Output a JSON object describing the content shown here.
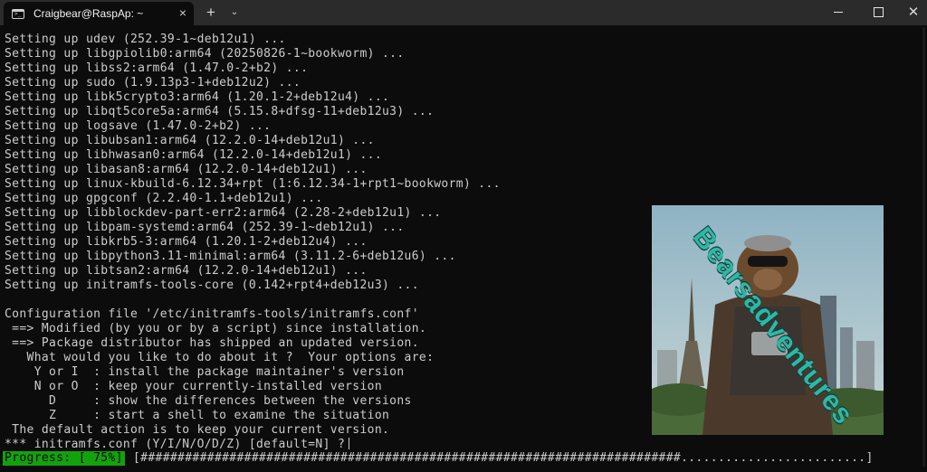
{
  "window": {
    "tab_title": "Craigbear@RaspAp: ~",
    "tab_icon": "terminal-icon",
    "close_tab": "×",
    "new_tab": "+",
    "tab_menu": "⌄",
    "close_window": "✕"
  },
  "terminal": {
    "lines": [
      "Setting up udev (252.39-1~deb12u1) ...",
      "Setting up libgpiolib0:arm64 (20250826-1~bookworm) ...",
      "Setting up libss2:arm64 (1.47.0-2+b2) ...",
      "Setting up sudo (1.9.13p3-1+deb12u2) ...",
      "Setting up libk5crypto3:arm64 (1.20.1-2+deb12u4) ...",
      "Setting up libqt5core5a:arm64 (5.15.8+dfsg-11+deb12u3) ...",
      "Setting up logsave (1.47.0-2+b2) ...",
      "Setting up libubsan1:arm64 (12.2.0-14+deb12u1) ...",
      "Setting up libhwasan0:arm64 (12.2.0-14+deb12u1) ...",
      "Setting up libasan8:arm64 (12.2.0-14+deb12u1) ...",
      "Setting up linux-kbuild-6.12.34+rpt (1:6.12.34-1+rpt1~bookworm) ...",
      "Setting up gpgconf (2.2.40-1.1+deb12u1) ...",
      "Setting up libblockdev-part-err2:arm64 (2.28-2+deb12u1) ...",
      "Setting up libpam-systemd:arm64 (252.39-1~deb12u1) ...",
      "Setting up libkrb5-3:arm64 (1.20.1-2+deb12u4) ...",
      "Setting up libpython3.11-minimal:arm64 (3.11.2-6+deb12u6) ...",
      "Setting up libtsan2:arm64 (12.2.0-14+deb12u1) ...",
      "Setting up initramfs-tools-core (0.142+rpt4+deb12u3) ...",
      "",
      "Configuration file '/etc/initramfs-tools/initramfs.conf'",
      " ==> Modified (by you or by a script) since installation.",
      " ==> Package distributor has shipped an updated version.",
      "   What would you like to do about it ?  Your options are:",
      "    Y or I  : install the package maintainer's version",
      "    N or O  : keep your currently-installed version",
      "      D     : show the differences between the versions",
      "      Z     : start a shell to examine the situation",
      " The default action is to keep your current version.",
      "*** initramfs.conf (Y/I/N/O/D/Z) [default=N] ?"
    ],
    "progress_label": "Progress: [ 75%]",
    "progress_bar": "[#########################################################################.........................]",
    "progress_percent": 75
  },
  "overlay": {
    "watermark": "Bearsadventures"
  },
  "colors": {
    "background": "#0c0c0c",
    "text": "#cccccc",
    "progress_bg": "#13a10e",
    "watermark": "#2fb7a6"
  }
}
